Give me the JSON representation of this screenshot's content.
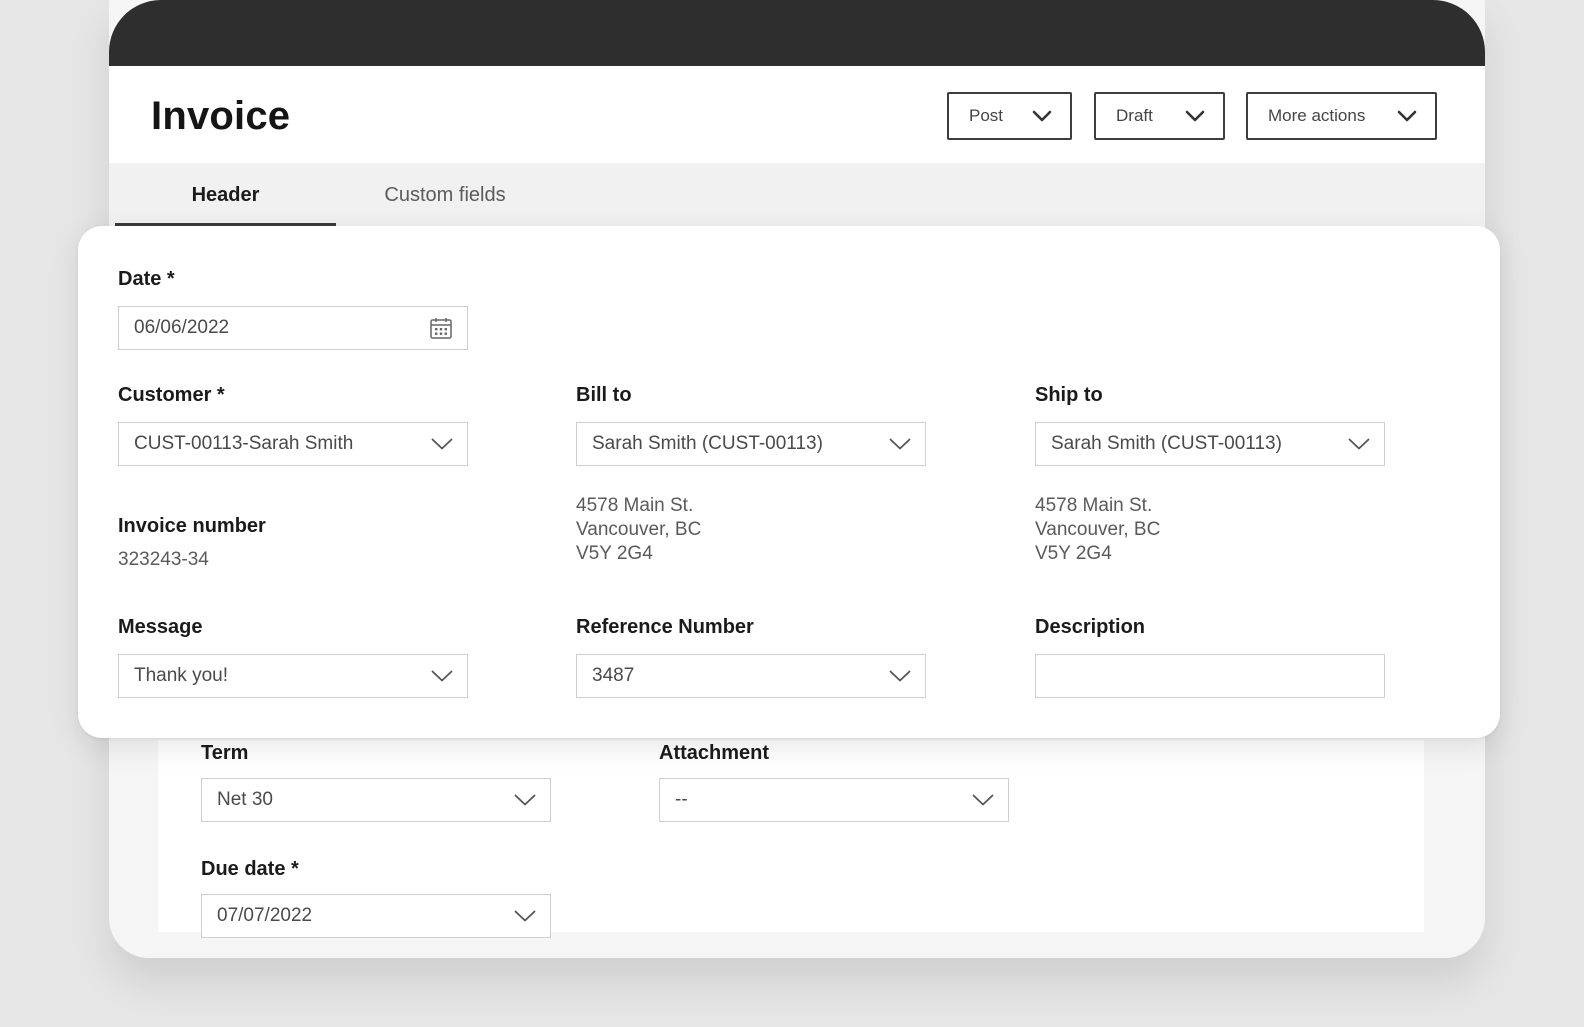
{
  "page": {
    "title": "Invoice"
  },
  "header_actions": {
    "post": "Post",
    "draft": "Draft",
    "more": "More actions"
  },
  "tabs": [
    {
      "label": "Header",
      "active": true
    },
    {
      "label": "Custom fields",
      "active": false
    }
  ],
  "form": {
    "date": {
      "label": "Date *",
      "value": "06/06/2022",
      "icon": "calendar-icon"
    },
    "customer": {
      "label": "Customer *",
      "value": "CUST-00113-Sarah Smith"
    },
    "bill_to": {
      "label": "Bill to",
      "value": "Sarah Smith (CUST-00113)",
      "address": [
        "4578 Main St.",
        "Vancouver, BC",
        "V5Y 2G4"
      ]
    },
    "ship_to": {
      "label": "Ship to",
      "value": "Sarah Smith (CUST-00113)",
      "address": [
        "4578 Main St.",
        "Vancouver, BC",
        "V5Y 2G4"
      ]
    },
    "invoice_number": {
      "label": "Invoice number",
      "value": "323243-34"
    },
    "message": {
      "label": "Message",
      "value": "Thank you!"
    },
    "reference_number": {
      "label": "Reference Number",
      "value": "3487"
    },
    "description": {
      "label": "Description",
      "value": ""
    },
    "term": {
      "label": "Term",
      "value": "Net 30"
    },
    "attachment": {
      "label": "Attachment",
      "value": "--"
    },
    "due_date": {
      "label": "Due date *",
      "value": "07/07/2022"
    }
  },
  "colors": {
    "device_bar": "#2e2e2e",
    "background": "#e6e6e6",
    "tab_bar": "#f1f1f1",
    "border": "#cfcfcf"
  }
}
